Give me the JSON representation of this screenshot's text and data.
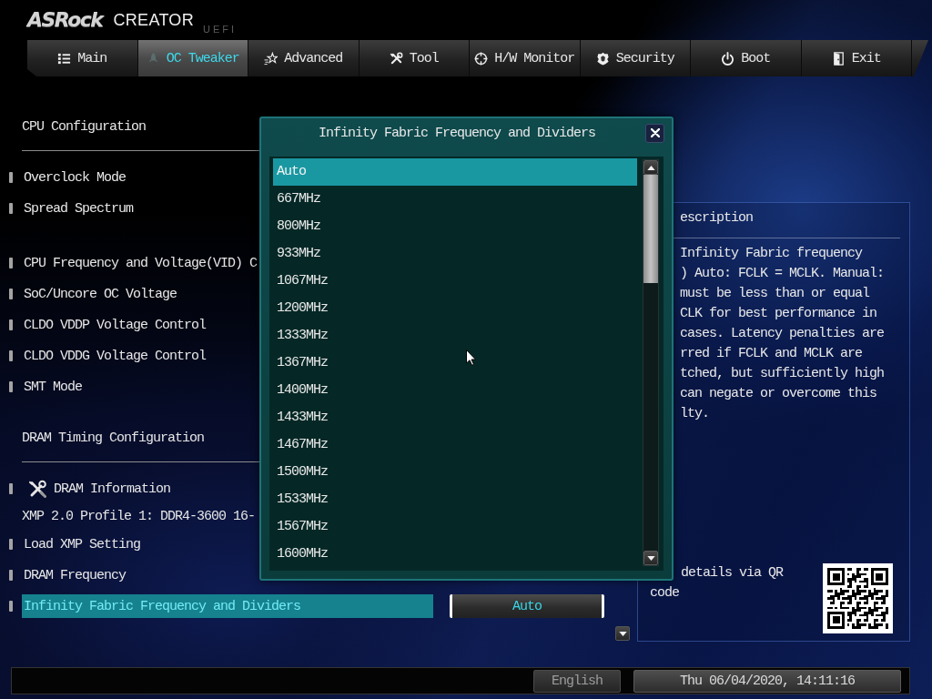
{
  "header": {
    "logo": "ASRock",
    "product": "CREATOR",
    "edition": "UEFI"
  },
  "tabs": [
    {
      "label": "Main",
      "selected": false
    },
    {
      "label": "OC Tweaker",
      "selected": true
    },
    {
      "label": "Advanced",
      "selected": false
    },
    {
      "label": "Tool",
      "selected": false
    },
    {
      "label": "H/W Monitor",
      "selected": false
    },
    {
      "label": "Security",
      "selected": false
    },
    {
      "label": "Boot",
      "selected": false
    },
    {
      "label": "Exit",
      "selected": false
    }
  ],
  "sections": [
    {
      "heading": "CPU Configuration",
      "groups": [
        [
          {
            "kind": "setting",
            "label": "Overclock Mode",
            "selected": false
          },
          {
            "kind": "setting",
            "label": "Spread Spectrum",
            "selected": false
          }
        ],
        [
          {
            "kind": "setting",
            "label": "CPU Frequency and Voltage(VID) C",
            "selected": false
          },
          {
            "kind": "setting",
            "label": "SoC/Uncore OC Voltage",
            "selected": false
          },
          {
            "kind": "setting",
            "label": "CLDO VDDP Voltage Control",
            "selected": false
          },
          {
            "kind": "setting",
            "label": "CLDO VDDG Voltage Control",
            "selected": false
          },
          {
            "kind": "setting",
            "label": "SMT Mode",
            "selected": false
          }
        ]
      ]
    },
    {
      "heading": "DRAM Timing Configuration",
      "groups": [
        [
          {
            "kind": "submenu",
            "label": "DRAM Information",
            "selected": false
          },
          {
            "kind": "info",
            "label": "XMP 2.0 Profile 1: DDR4-3600 16-"
          },
          {
            "kind": "setting",
            "label": "Load XMP Setting",
            "selected": false
          },
          {
            "kind": "setting",
            "label": "DRAM Frequency",
            "selected": false
          },
          {
            "kind": "setting",
            "label": "Infinity Fabric Frequency and Dividers",
            "selected": true,
            "value": "Auto"
          }
        ]
      ]
    }
  ],
  "description": {
    "title": "escription",
    "lines": [
      "Infinity Fabric frequency",
      ") Auto: FCLK = MCLK. Manual:",
      "must be less than or equal",
      "CLK for best performance in",
      "cases. Latency penalties are",
      "rred if FCLK and MCLK are",
      "tched, but sufficiently high",
      "can negate or overcome this",
      "lty."
    ],
    "qr_note": [
      "details via QR",
      "code"
    ]
  },
  "popup": {
    "title": "Infinity Fabric Frequency and Dividers",
    "options": [
      {
        "label": "Auto",
        "selected": true
      },
      {
        "label": "667MHz",
        "selected": false
      },
      {
        "label": "800MHz",
        "selected": false
      },
      {
        "label": "933MHz",
        "selected": false
      },
      {
        "label": "1067MHz",
        "selected": false
      },
      {
        "label": "1200MHz",
        "selected": false
      },
      {
        "label": "1333MHz",
        "selected": false
      },
      {
        "label": "1367MHz",
        "selected": false
      },
      {
        "label": "1400MHz",
        "selected": false
      },
      {
        "label": "1433MHz",
        "selected": false
      },
      {
        "label": "1467MHz",
        "selected": false
      },
      {
        "label": "1500MHz",
        "selected": false
      },
      {
        "label": "1533MHz",
        "selected": false
      },
      {
        "label": "1567MHz",
        "selected": false
      },
      {
        "label": "1600MHz",
        "selected": false
      }
    ]
  },
  "status_bar": {
    "language": "English",
    "datetime": "Thu 06/04/2020, 14:11:16"
  }
}
